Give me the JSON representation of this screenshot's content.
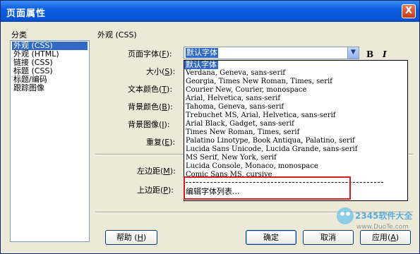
{
  "window": {
    "title": "页面属性",
    "close_label": "X"
  },
  "category": {
    "label": "分类",
    "items": [
      "外观 (CSS)",
      "外观 (HTML)",
      "链接 (CSS)",
      "标题 (CSS)",
      "标题/编码",
      "跟踪图像"
    ],
    "selected_index": 0
  },
  "section_title": "外观 (CSS)",
  "fields": {
    "page_font": {
      "label": "页面字体",
      "key": "F",
      "value": "默认字体"
    },
    "size": {
      "label": "大小",
      "key": "S"
    },
    "text_color": {
      "label": "文本颜色",
      "key": "T"
    },
    "bg_color": {
      "label": "背景颜色",
      "key": "B"
    },
    "bg_image": {
      "label": "背景图像",
      "key": "I"
    },
    "repeat": {
      "label": "重复",
      "key": "E"
    },
    "left_margin": {
      "label": "左边距",
      "key": "M"
    },
    "top_margin": {
      "label": "上边距",
      "key": "P"
    }
  },
  "format_buttons": {
    "bold": "B",
    "italic": "I"
  },
  "font_dropdown": {
    "items": [
      "默认字体",
      "Verdana, Geneva, sans-serif",
      "Georgia, Times New Roman, Times, serif",
      "Courier New, Courier, monospace",
      "Arial, Helvetica, sans-serif",
      "Tahoma, Geneva, sans-serif",
      "Trebuchet MS, Arial, Helvetica, sans-serif",
      "Arial Black, Gadget, sans-serif",
      "Times New Roman, Times, serif",
      "Palatino Linotype, Book Antiqua, Palatino, serif",
      "Lucida Sans Unicode, Lucida Grande, sans-serif",
      "MS Serif, New York, serif",
      "Lucida Console, Monaco, monospace",
      "Comic Sans MS, cursive"
    ],
    "edit_item": "编辑字体列表..."
  },
  "buttons": {
    "help": "帮助",
    "help_key": "H",
    "ok": "确定",
    "cancel": "取消",
    "apply": "应用",
    "apply_key": "A"
  },
  "watermark": {
    "brand": "2345软件大全",
    "url": "www.DuoTe.com"
  },
  "colors": {
    "titlebar": "#0a56d6",
    "selection": "#316ac5",
    "highlight_box": "#d31c1c",
    "dialog_bg": "#ece9d8"
  }
}
